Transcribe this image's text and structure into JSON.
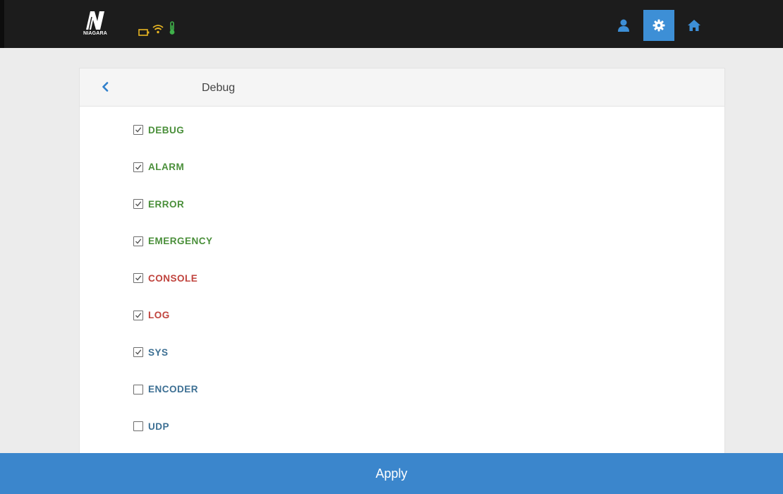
{
  "topbar": {
    "logo_caption": "NIAGARA",
    "status_icons": [
      "battery-icon",
      "wifi-icon",
      "thermometer-icon"
    ],
    "nav": [
      "user-icon",
      "gear-icon",
      "home-icon"
    ],
    "active_nav": "gear-icon"
  },
  "panel": {
    "title": "Debug",
    "back_icon": "chevron-left-icon"
  },
  "options": [
    {
      "label": "DEBUG",
      "checked": true,
      "color": "#4a8f3a"
    },
    {
      "label": "ALARM",
      "checked": true,
      "color": "#4a8f3a"
    },
    {
      "label": "ERROR",
      "checked": true,
      "color": "#4a8f3a"
    },
    {
      "label": "EMERGENCY",
      "checked": true,
      "color": "#4a8f3a"
    },
    {
      "label": "CONSOLE",
      "checked": true,
      "color": "#c0433d"
    },
    {
      "label": "LOG",
      "checked": true,
      "color": "#c0433d"
    },
    {
      "label": "SYS",
      "checked": true,
      "color": "#3c6f93"
    },
    {
      "label": "ENCODER",
      "checked": false,
      "color": "#3c6f93"
    },
    {
      "label": "UDP",
      "checked": false,
      "color": "#3c6f93"
    }
  ],
  "apply_label": "Apply",
  "colors": {
    "accent": "#3b86cc",
    "topbar": "#1c1c1c",
    "active_nav": "#3d8fd6"
  }
}
